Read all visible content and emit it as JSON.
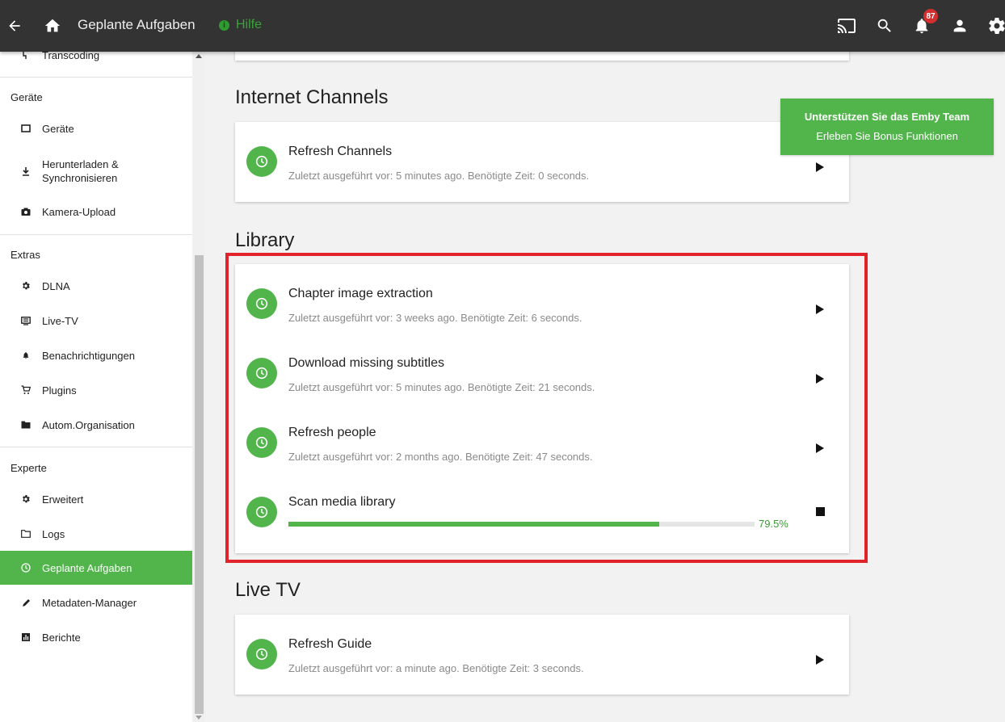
{
  "header": {
    "title": "Geplante Aufgaben",
    "help_label": "Hilfe",
    "notification_count": "87"
  },
  "sidebar": {
    "partial_item": "Transcoding",
    "sections": [
      {
        "heading": "Geräte",
        "items": [
          "Geräte",
          "Herunterladen & Synchronisieren",
          "Kamera-Upload"
        ]
      },
      {
        "heading": "Extras",
        "items": [
          "DLNA",
          "Live-TV",
          "Benachrichtigungen",
          "Plugins",
          "Autom.Organisation"
        ]
      },
      {
        "heading": "Experte",
        "items": [
          "Erweitert",
          "Logs",
          "Geplante Aufgaben",
          "Metadaten-Manager",
          "Berichte"
        ]
      }
    ],
    "active_item": "Geplante Aufgaben"
  },
  "sections": [
    {
      "title": "Internet Channels",
      "tasks": [
        {
          "name": "Refresh Channels",
          "info": "Zuletzt ausgeführt vor: 5 minutes ago. Benötigte Zeit: 0 seconds."
        }
      ]
    },
    {
      "title": "Library",
      "tasks": [
        {
          "name": "Chapter image extraction",
          "info": "Zuletzt ausgeführt vor: 3 weeks ago. Benötigte Zeit: 6 seconds."
        },
        {
          "name": "Download missing subtitles",
          "info": "Zuletzt ausgeführt vor: 5 minutes ago. Benötigte Zeit: 21 seconds."
        },
        {
          "name": "Refresh people",
          "info": "Zuletzt ausgeführt vor: 2 months ago. Benötigte Zeit: 47 seconds."
        },
        {
          "name": "Scan media library",
          "progress": 79.5,
          "progress_label": "79.5%"
        }
      ]
    },
    {
      "title": "Live TV",
      "tasks": [
        {
          "name": "Refresh Guide",
          "info": "Zuletzt ausgeführt vor: a minute ago. Benötigte Zeit: 3 seconds."
        }
      ]
    }
  ],
  "promo": {
    "line1": "Unterstützen Sie das Emby Team",
    "line2": "Erleben Sie Bonus Funktionen"
  },
  "colors": {
    "accent": "#52b54b",
    "header": "#333333",
    "highlight": "#e1232b"
  }
}
